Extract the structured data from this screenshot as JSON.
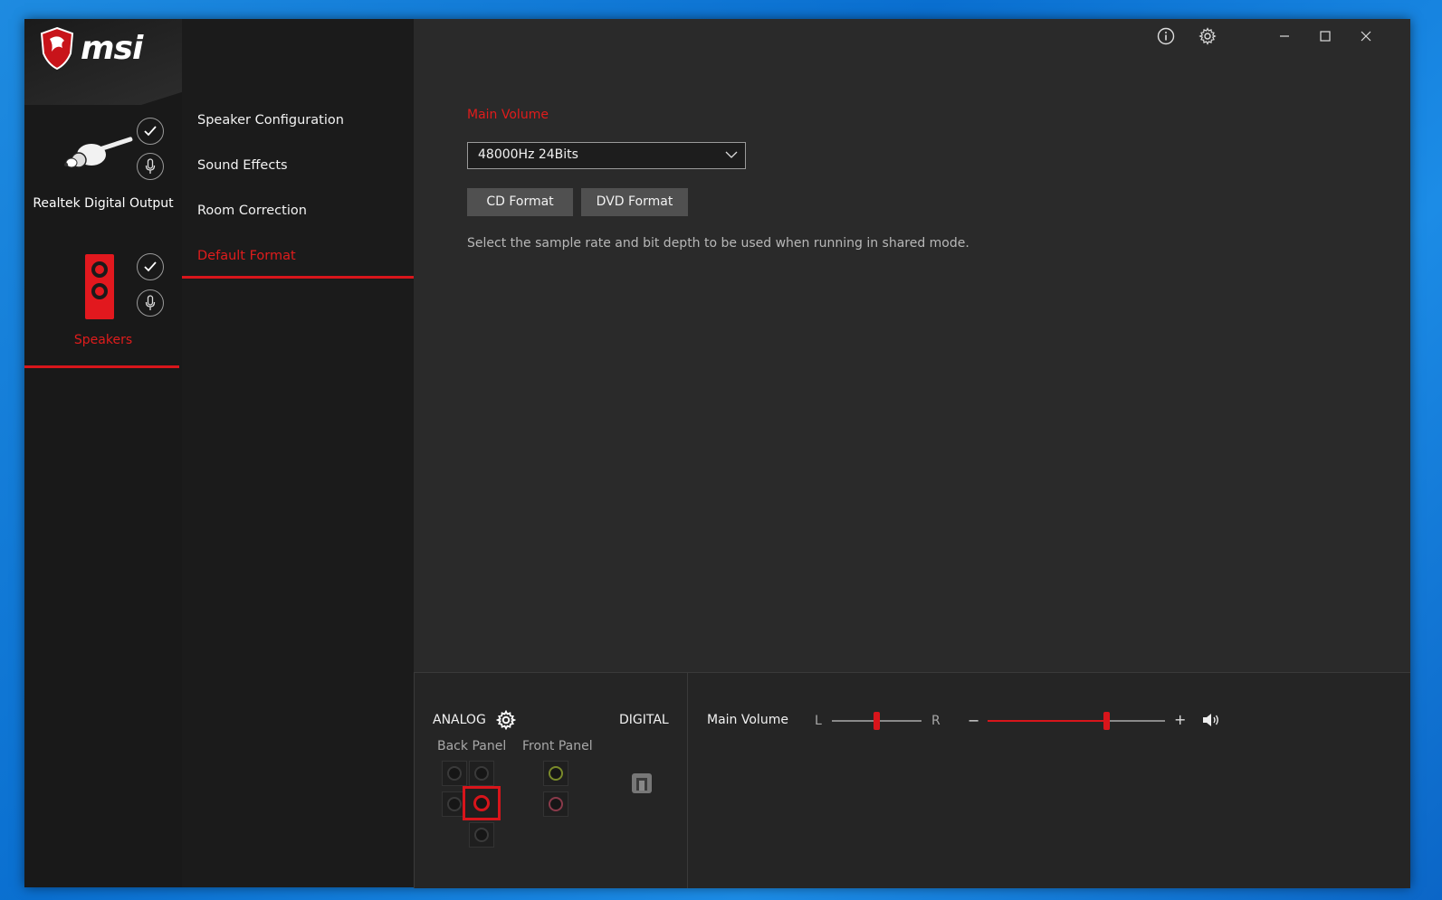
{
  "window": {
    "brand": "msi",
    "controls": {
      "info_icon": "info-icon",
      "settings_icon": "gear-icon",
      "minimize_icon": "minimize-icon",
      "maximize_icon": "maximize-icon",
      "close_icon": "close-icon"
    }
  },
  "devices": [
    {
      "name": "Realtek Digital Output",
      "active": false,
      "icon": "rca-plug-icon"
    },
    {
      "name": "Speakers",
      "active": true,
      "icon": "speaker-icon"
    }
  ],
  "menu": {
    "items": [
      {
        "label": "Speaker Configuration",
        "active": false
      },
      {
        "label": "Sound Effects",
        "active": false
      },
      {
        "label": "Room Correction",
        "active": false
      },
      {
        "label": "Default Format",
        "active": true
      }
    ]
  },
  "content": {
    "section_title": "Main Volume",
    "format_select": {
      "value": "48000Hz 24Bits"
    },
    "buttons": {
      "cd": "CD Format",
      "dvd": "DVD Format"
    },
    "description": "Select the sample rate and bit depth to be used when running in shared mode."
  },
  "bottom": {
    "analog_label": "ANALOG",
    "digital_label": "DIGITAL",
    "back_panel_label": "Back Panel",
    "front_panel_label": "Front Panel",
    "volume_label": "Main Volume",
    "balance_left": "L",
    "balance_right": "R",
    "minus": "−",
    "plus": "+",
    "balance_value": 0.5,
    "volume_value": 0.67
  },
  "colors": {
    "accent": "#d8151b",
    "panel": "#2a2a2a",
    "sidebar": "#191919",
    "text": "#f2f2f2"
  }
}
